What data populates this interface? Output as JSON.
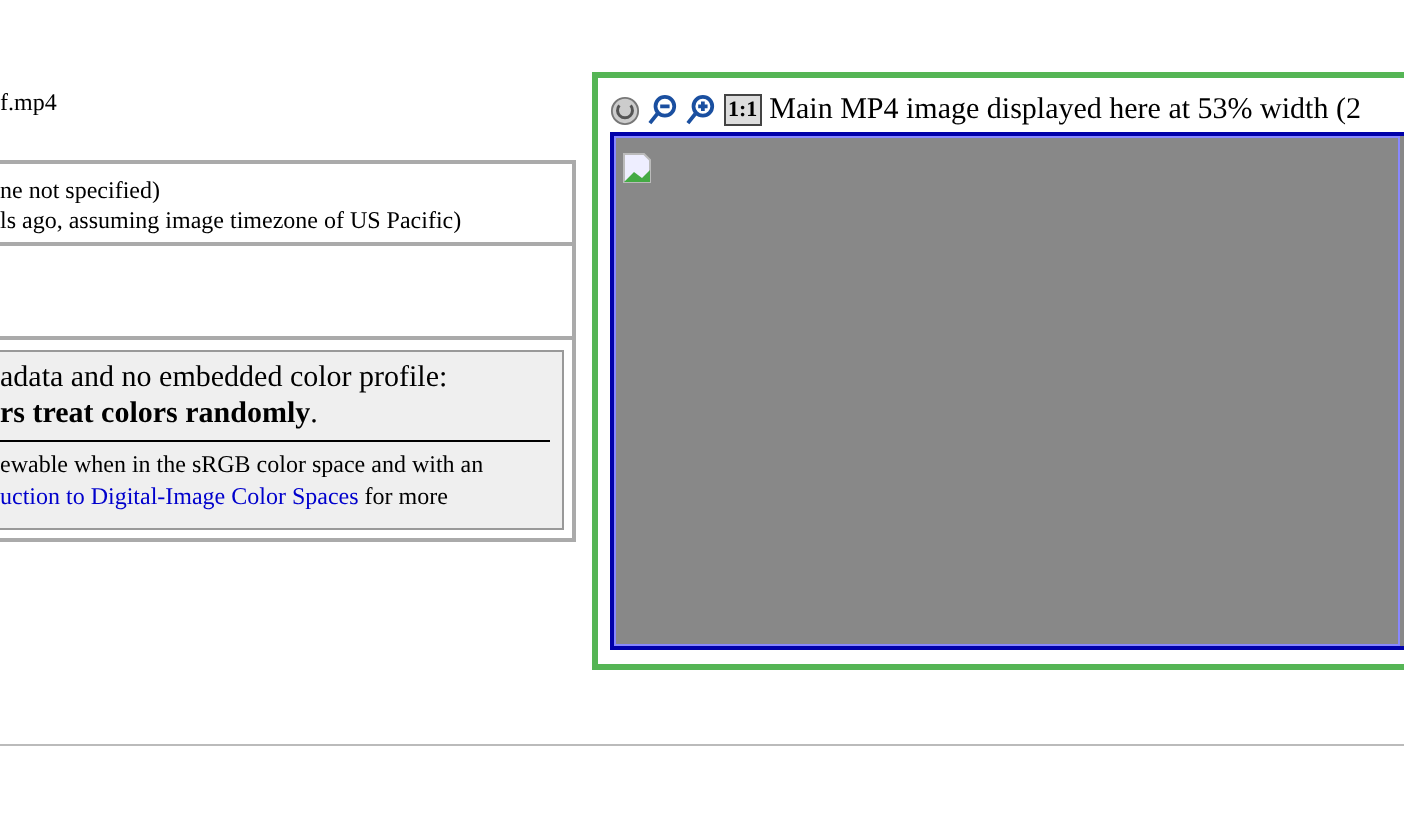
{
  "file_name": "f.mp4",
  "date_lines": [
    "ne not specified)",
    "ls ago, assuming image timezone of US Pacific)"
  ],
  "color_note": {
    "line_1": "adata and no embedded color profile:",
    "line_2": "**rs treat colors randomly**.",
    "line_3": "ewable when in the sRGB color space and with an",
    "link": "uction to Digital-Image Color Spaces",
    "line_4_rest": " for more"
  },
  "viewer": {
    "caption": "Main MP4 image displayed here at 53% width (2",
    "zoom_reset": "1:1"
  }
}
